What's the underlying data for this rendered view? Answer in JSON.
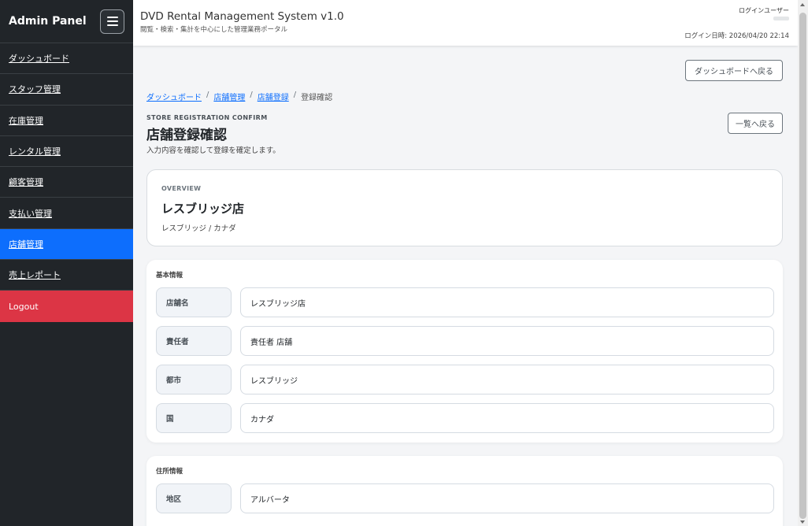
{
  "sidebar": {
    "brand": "Admin Panel",
    "items": [
      {
        "label": "ダッシュボード",
        "active": false
      },
      {
        "label": "スタッフ管理",
        "active": false
      },
      {
        "label": "在庫管理",
        "active": false
      },
      {
        "label": "レンタル管理",
        "active": false
      },
      {
        "label": "顧客管理",
        "active": false
      },
      {
        "label": "支払い管理",
        "active": false
      },
      {
        "label": "店舗管理",
        "active": true
      },
      {
        "label": "売上レポート",
        "active": false
      }
    ],
    "logout_label": "Logout"
  },
  "topbar": {
    "title": "DVD Rental Management System v1.0",
    "subtitle": "閲覧・検索・集計を中心にした管理業務ポータル",
    "login_user_label": "ログインユーザー",
    "login_time": "ログイン日時: 2026/04/20 22:14"
  },
  "toolbar": {
    "back_to_dashboard": "ダッシュボードへ戻る",
    "back_to_list": "一覧へ戻る"
  },
  "breadcrumb": {
    "items": [
      "ダッシュボード",
      "店舗管理",
      "店舗登録"
    ],
    "current": "登録確認",
    "separator": "/"
  },
  "page": {
    "eyebrow": "STORE REGISTRATION CONFIRM",
    "title": "店舗登録確認",
    "description": "入力内容を確認して登録を確定します。"
  },
  "overview": {
    "eyebrow": "OVERVIEW",
    "name": "レスブリッジ店",
    "subtitle": "レスブリッジ / カナダ"
  },
  "basic_info": {
    "title": "基本情報",
    "fields": [
      {
        "label": "店舗名",
        "value": "レスブリッジ店"
      },
      {
        "label": "責任者",
        "value": "責任者 店舗"
      },
      {
        "label": "都市",
        "value": "レスブリッジ"
      },
      {
        "label": "国",
        "value": "カナダ"
      }
    ]
  },
  "address_info": {
    "title": "住所情報",
    "fields": [
      {
        "label": "地区",
        "value": "アルバータ"
      }
    ]
  },
  "colors": {
    "sidebar_bg": "#212529",
    "active_nav": "#0d6efd",
    "logout": "#dc3545",
    "link": "#0d6efd"
  }
}
